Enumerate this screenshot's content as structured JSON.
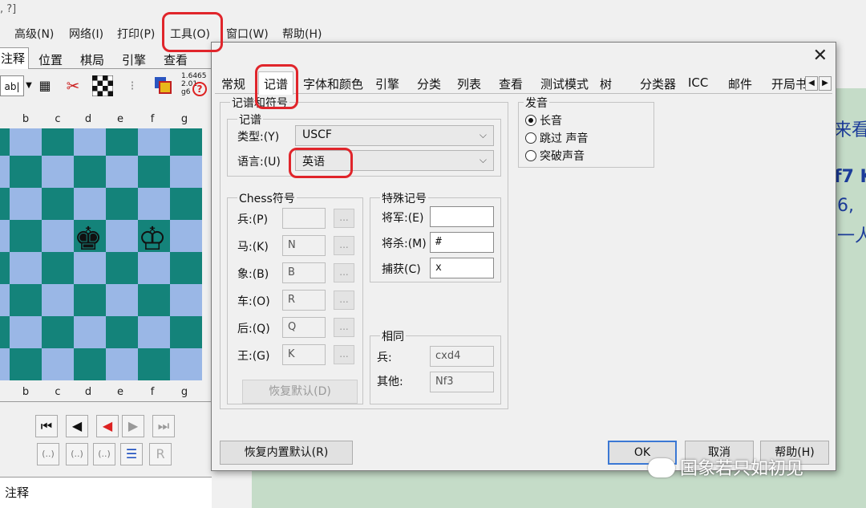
{
  "title_fragment": ", ?]",
  "menubar": [
    "高级(N)",
    "网络(I)",
    "打印(P)",
    "工具(O)",
    "窗口(W)",
    "帮助(H)"
  ],
  "left_tabs": [
    "注释",
    "位置",
    "棋局",
    "引擎",
    "查看"
  ],
  "toolbar": {
    "ab_label": "ab|",
    "stats": [
      "1.6465",
      "2.01",
      "g6"
    ],
    "help_glyph": "?"
  },
  "files": [
    "b",
    "c",
    "d",
    "e",
    "f",
    "g"
  ],
  "pieces": {
    "black_king": "♚",
    "white_king": "♔"
  },
  "nav_buttons": [
    "⏮",
    "◀",
    "◀",
    "▶",
    "⏭"
  ],
  "nav_buttons2": [
    "(..)",
    "(..)",
    "(..)",
    "☰",
    "R"
  ],
  "notes_tab": "注释",
  "right_side_text": [
    "来看",
    "f7 K",
    "6,",
    "一人"
  ],
  "dialog": {
    "close": "✕",
    "tabs": [
      "常规",
      "记谱",
      "字体和颜色",
      "引擎",
      "分类",
      "列表",
      "查看",
      "测试模式",
      "树",
      "分类器",
      "ICC",
      "邮件",
      "开局书"
    ],
    "active_tab": "记谱",
    "notation_group": "记谱和符号",
    "notation_sub": "记谱",
    "type_label": "类型:(Y)",
    "type_value": "USCF",
    "lang_label": "语言:(U)",
    "lang_value": "英语",
    "chess_symbols_group": "Chess符号",
    "pieces": [
      {
        "label": "兵:(P)",
        "value": ""
      },
      {
        "label": "马:(K)",
        "value": "N"
      },
      {
        "label": "象:(B)",
        "value": "B"
      },
      {
        "label": "车:(O)",
        "value": "R"
      },
      {
        "label": "后:(Q)",
        "value": "Q"
      },
      {
        "label": "王:(G)",
        "value": "K"
      }
    ],
    "dots": "...",
    "restore_defaults": "恢复默认(D)",
    "special_group": "特殊记号",
    "special": [
      {
        "label": "将军:(E)",
        "value": ""
      },
      {
        "label": "将杀:(M)",
        "value": "#"
      },
      {
        "label": "捕获(C)",
        "value": "x"
      }
    ],
    "same_group": "相同",
    "same": [
      {
        "label": "兵:",
        "value": "cxd4"
      },
      {
        "label": "其他:",
        "value": "Nf3"
      }
    ],
    "sound_group": "发音",
    "sound_options": [
      {
        "label": "长音",
        "checked": true
      },
      {
        "label": "跳过 声音",
        "checked": false
      },
      {
        "label": "突破声音",
        "checked": false
      }
    ],
    "restore_builtin": "恢复内置默认(R)",
    "ok": "OK",
    "cancel": "取消",
    "help": "帮助(H)"
  },
  "watermark": "国象若只如初见"
}
